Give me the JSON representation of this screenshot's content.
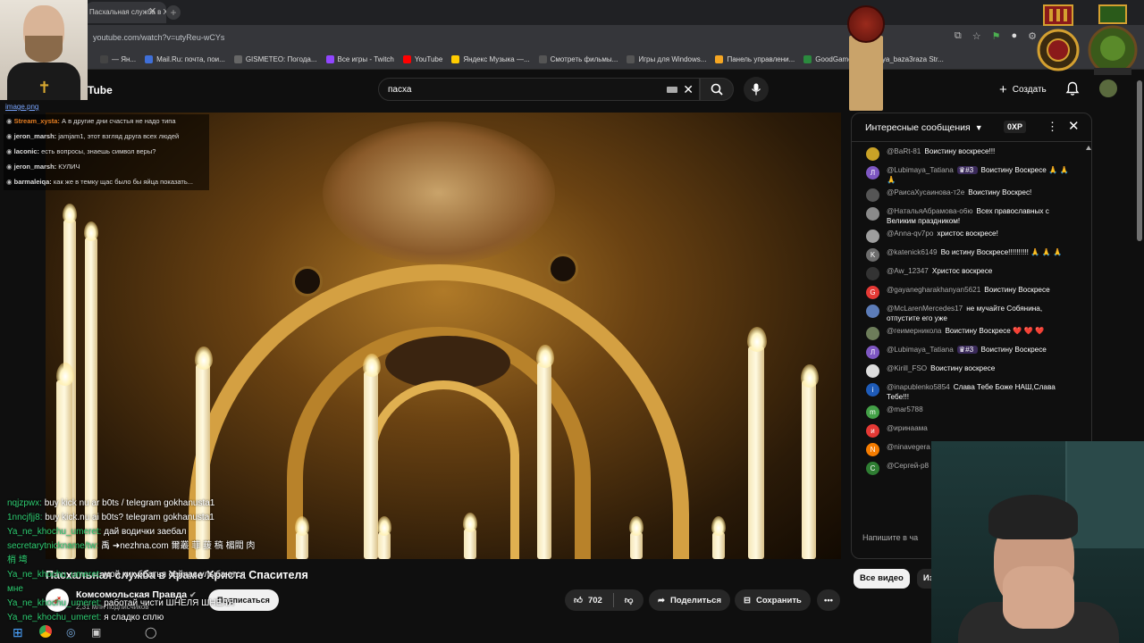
{
  "browser": {
    "tab_title": "Пасхальная служба в Хра...",
    "url": "youtube.com/watch?v=utyReu-wCYs",
    "bookmarks": [
      {
        "label": "— Ян...",
        "color": "#444"
      },
      {
        "label": "Mail.Ru: почта, пои...",
        "color": "#3f6fd8"
      },
      {
        "label": "GISMETEO: Погода...",
        "color": "#666"
      },
      {
        "label": "Все игры - Twitch",
        "color": "#9146ff"
      },
      {
        "label": "YouTube",
        "color": "#ff0000"
      },
      {
        "label": "Яндекс Музыка —...",
        "color": "#ffcc00"
      },
      {
        "label": "Смотреть фильмы...",
        "color": "#555"
      },
      {
        "label": "Игры для Windows...",
        "color": "#555"
      },
      {
        "label": "Панель управлени...",
        "color": "#f5a623"
      },
      {
        "label": "GoodGame",
        "color": "#2b8a3e"
      },
      {
        "label": "kolya_baza3raza Str...",
        "color": "#53fc18"
      }
    ]
  },
  "youtube": {
    "logo": "Tube",
    "search_value": "пасха",
    "create_label": "Создать"
  },
  "video": {
    "title": "Пасхальная служба в Храме Христа Спасителя",
    "channel_name": "Комсомольская Правда",
    "channel_subs": "2,31 млн подписчиков",
    "subscribe_label": "Подписаться",
    "likes": "702",
    "share_label": "Поделиться",
    "save_label": "Сохранить"
  },
  "stream_overlay": {
    "image_link": "image.png",
    "lines": [
      {
        "user": "Stream_xysta:",
        "color": "#e67e22",
        "text": "А в другие дни счастья не надо типа"
      },
      {
        "user": "jeron_marsh:",
        "color": "#ddd",
        "text": "jamjam1, этот взгляд друга всех людей"
      },
      {
        "user": "laconic:",
        "color": "#ddd",
        "text": "есть вопросы, знаешь символ веры?"
      },
      {
        "user": "jeron_marsh:",
        "color": "#ddd",
        "text": "КУЛИЧ"
      },
      {
        "user": "barmaleiqa:",
        "color": "#ddd",
        "text": "как же в темку щас было бы яйца показать..."
      }
    ],
    "bottom_lines": [
      {
        "user": "nqjzpwx:",
        "text": "buy kick nu ar b0ts / telegram gokhanusta1"
      },
      {
        "user": "1nncjfjj8:",
        "text": "buy kick.nu ai b0ts? telegram gokhanusta1"
      },
      {
        "user": "Ya_ne_khochu_umeret:",
        "text": "дай водички заебал"
      },
      {
        "user": "secretarytnickname/tw:",
        "text": "禹 ➜nezhna.com 爾叢 菲 菝 稿 楣閥 肉"
      },
      {
        "user": "梢 塆",
        "text": ""
      },
      {
        "user": "Ya_ne_khochu_umeret:",
        "text": "мой кик братья сейчас улыбаются"
      },
      {
        "user": "мне",
        "text": ""
      },
      {
        "user": "Ya_ne_khochu_umeret:",
        "text": "работай чисти ШНЕЛЯ ШНЕЛЯ"
      },
      {
        "user": "Ya_ne_khochu_umeret:",
        "text": "я сладко сплю"
      }
    ]
  },
  "live_chat": {
    "header": "Интересные сообщения",
    "xp": "0XP",
    "input_placeholder": "Напишите в ча",
    "messages": [
      {
        "avatar": "",
        "avatar_color": "#c9a227",
        "author": "@BaRt-81",
        "text": "Воистину воскресе!!!"
      },
      {
        "avatar": "Л",
        "avatar_color": "#7e57c2",
        "author": "@Lubimaya_Tatiana",
        "badge": "#3",
        "text": "Воистину Воскресе 🙏 🙏 🙏"
      },
      {
        "avatar": "",
        "avatar_color": "#555",
        "author": "@РаисаХусаинова-т2е",
        "text": "Воистину Воскрес!"
      },
      {
        "avatar": "",
        "avatar_color": "#8a8a8a",
        "author": "@НатальяАбрамова-о6ю",
        "text": "Всех православных с Великим праздником!"
      },
      {
        "avatar": "",
        "avatar_color": "#9e9e9e",
        "author": "@Anna-qv7po",
        "text": "христос воскресе!"
      },
      {
        "avatar": "K",
        "avatar_color": "#6d6d6d",
        "author": "@katenick6149",
        "text": "Во истину Воскресе!!!!!!!!!! 🙏 🙏 🙏"
      },
      {
        "avatar": "",
        "avatar_color": "#333",
        "author": "@Aw_12347",
        "text": "Христос воскресе"
      },
      {
        "avatar": "G",
        "avatar_color": "#e53935",
        "author": "@gayanegharakhanyan5621",
        "text": "Воистину Воскресе"
      },
      {
        "avatar": "",
        "avatar_color": "#5c7cb8",
        "author": "@McLarenMercedes17",
        "text": "не мучайте Собянина, отпустите его уже"
      },
      {
        "avatar": "",
        "avatar_color": "#6d7d5a",
        "author": "@геимерникола",
        "text": "Воистину Воскресе ❤️ ❤️ ❤️"
      },
      {
        "avatar": "Л",
        "avatar_color": "#7e57c2",
        "author": "@Lubimaya_Tatiana",
        "badge": "#3",
        "text": "Воистину Воскресе"
      },
      {
        "avatar": "",
        "avatar_color": "#ddd",
        "author": "@Kirill_FSO",
        "text": "Воистину воскресе"
      },
      {
        "avatar": "i",
        "avatar_color": "#1e5bb8",
        "author": "@inapublenko5854",
        "text": "Слава Тебе Боже НАШ,Слава Тебе!!!"
      },
      {
        "avatar": "m",
        "avatar_color": "#43a047",
        "author": "@mar5788",
        "text": ""
      },
      {
        "avatar": "и",
        "avatar_color": "#e53935",
        "author": "@иринаама",
        "text": ""
      },
      {
        "avatar": "N",
        "avatar_color": "#f57c00",
        "author": "@ninavegera",
        "text": ""
      },
      {
        "avatar": "C",
        "avatar_color": "#2e7d32",
        "author": "@Сергей-р8",
        "text": ""
      }
    ]
  },
  "chips": {
    "all_videos": "Все видео",
    "from": "Из р"
  }
}
